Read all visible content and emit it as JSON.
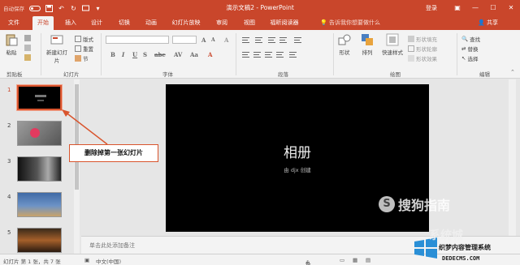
{
  "titlebar": {
    "autosave": "自动保存",
    "autosave_state": "●关",
    "doc_title": "演示文稿2 - PowerPoint",
    "login": "登录"
  },
  "tabs": [
    {
      "label": "文件"
    },
    {
      "label": "开始",
      "active": true
    },
    {
      "label": "插入"
    },
    {
      "label": "设计"
    },
    {
      "label": "切换"
    },
    {
      "label": "动画"
    },
    {
      "label": "幻灯片放映"
    },
    {
      "label": "审阅"
    },
    {
      "label": "视图"
    },
    {
      "label": "福昕阅读器"
    }
  ],
  "tellme": "告诉我你想要做什么",
  "share": "共享",
  "ribbon": {
    "paste": "粘贴",
    "clipboard": "剪贴板",
    "new_slide": "新建幻灯片",
    "layout": "版式",
    "reset": "重置",
    "section": "节",
    "slides_group": "幻灯片",
    "font_group": "字体",
    "paragraph_group": "段落",
    "shape": "形状",
    "arrange": "排列",
    "quick_styles": "快速样式",
    "shape_fill": "形状填充",
    "shape_outline": "形状轮廓",
    "shape_effects": "形状效果",
    "drawing_group": "绘图",
    "find": "查找",
    "replace": "替换",
    "select": "选择",
    "editing_group": "编辑"
  },
  "slides": [
    {
      "num": "1"
    },
    {
      "num": "2"
    },
    {
      "num": "3"
    },
    {
      "num": "4"
    },
    {
      "num": "5"
    }
  ],
  "slide": {
    "title": "相册",
    "subtitle": "由 djx 创建"
  },
  "notes_placeholder": "单击此处添加备注",
  "status": {
    "slide_info": "幻灯片 第 1 张，共 7 张",
    "language": "中文(中国)",
    "notes": "备注"
  },
  "annotation": "删除掉第一张幻灯片",
  "watermark": {
    "sogou": "搜狗指南",
    "xitong": "系统城",
    "zhiyin": "织梦内容管理系统",
    "site": "DEDECMS.COM"
  },
  "colors": {
    "accent": "#c9462b",
    "callout_border": "#d9542d"
  }
}
